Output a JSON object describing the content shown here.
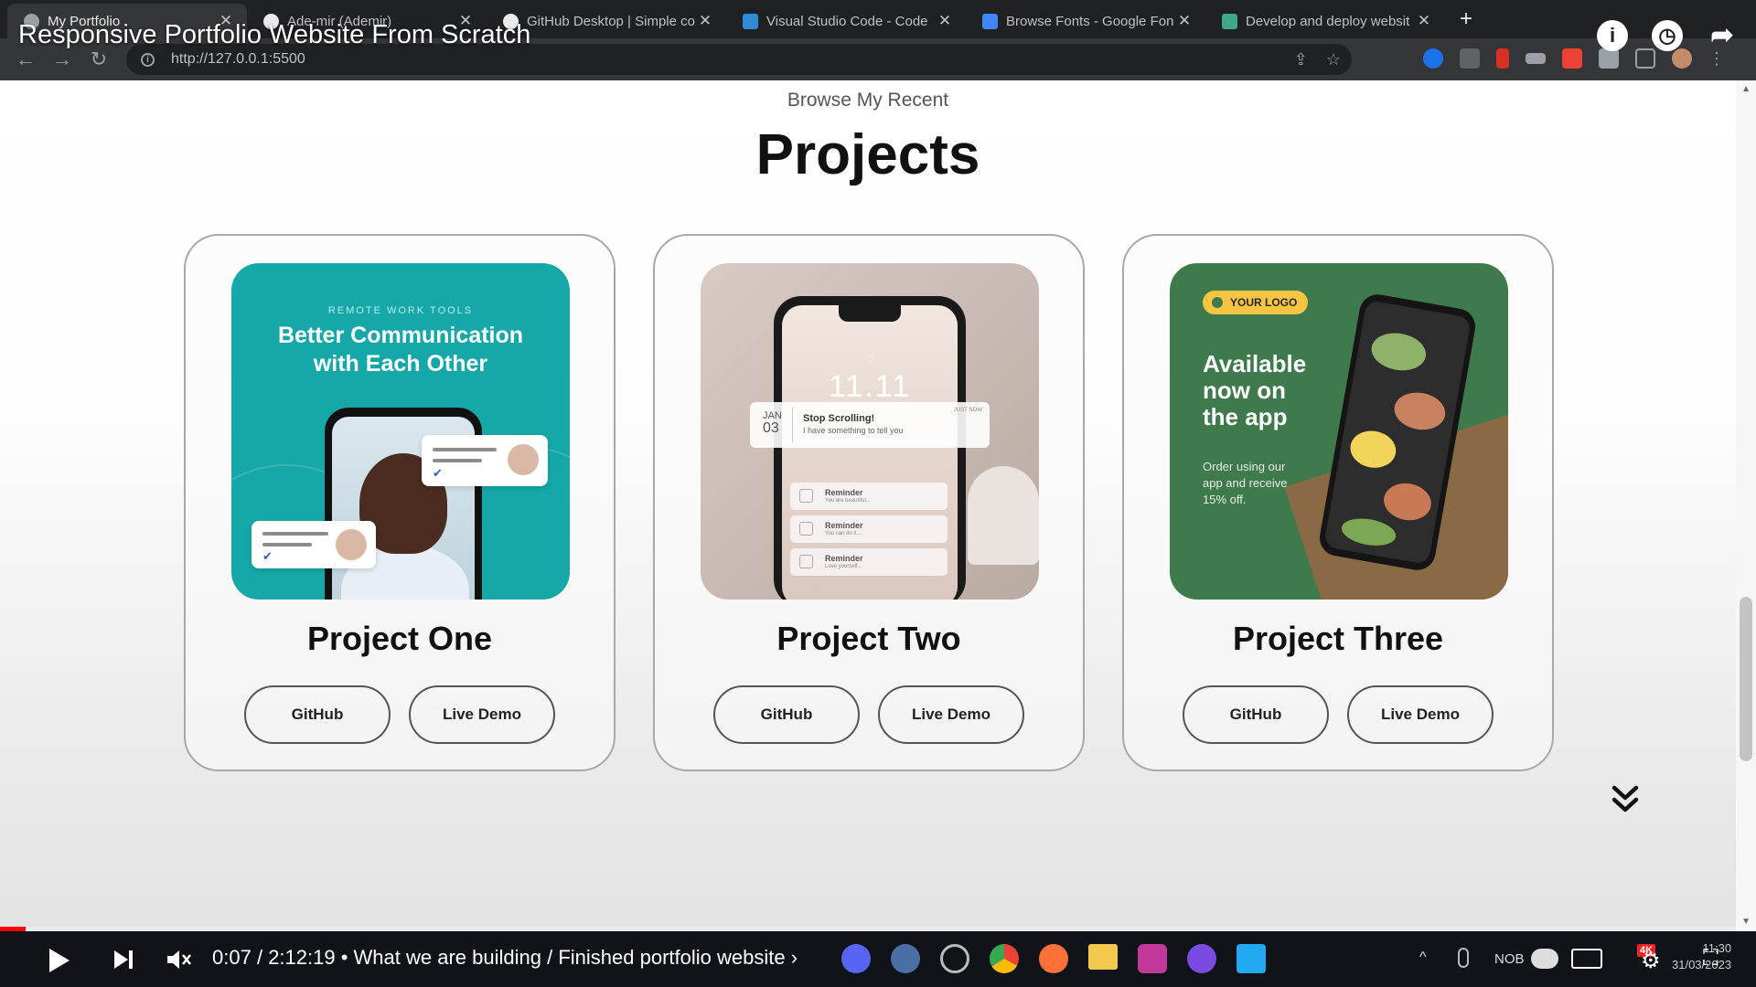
{
  "browser": {
    "tabs": [
      {
        "label": "My Portfolio",
        "active": true,
        "icon": "globe-icon"
      },
      {
        "label": "Ade-mir (Ademir)",
        "active": false,
        "icon": "github-icon"
      },
      {
        "label": "GitHub Desktop | Simple co",
        "active": false,
        "icon": "github-icon"
      },
      {
        "label": "Visual Studio Code - Code",
        "active": false,
        "icon": "vscode-icon"
      },
      {
        "label": "Browse Fonts - Google Fon",
        "active": false,
        "icon": "google-fonts-icon"
      },
      {
        "label": "Develop and deploy websit",
        "active": false,
        "icon": "netlify-icon"
      }
    ],
    "close_glyph": "✕",
    "new_tab_glyph": "+",
    "url": "http://127.0.0.1:5500"
  },
  "video": {
    "title": "Responsive Portfolio Website From Scratch",
    "time_current": "0:07",
    "time_total": "2:12:19",
    "chapter": "What we are building / Finished portfolio website",
    "progress_fraction": 0.001
  },
  "page": {
    "subtitle": "Browse My Recent",
    "title": "Projects",
    "projects": [
      {
        "title": "Project One",
        "github_label": "GitHub",
        "demo_label": "Live Demo",
        "image": {
          "kicker": "REMOTE WORK TOOLS",
          "heading_line1": "Better Communication",
          "heading_line2": "with Each Other"
        }
      },
      {
        "title": "Project Two",
        "github_label": "GitHub",
        "demo_label": "Live Demo",
        "image": {
          "clock": "11.11",
          "date_month": "JAN",
          "date_day": "03",
          "notification_title": "Stop Scrolling!",
          "notification_text": "I have something to tell you",
          "notification_time": "JUST NOW",
          "reminders": [
            {
              "title": "Reminder",
              "text": "You are beautiful..."
            },
            {
              "title": "Reminder",
              "text": "You can do it..."
            },
            {
              "title": "Reminder",
              "text": "Love yourself..."
            }
          ]
        }
      },
      {
        "title": "Project Three",
        "github_label": "GitHub",
        "demo_label": "Live Demo",
        "image": {
          "logo": "YOUR LOGO",
          "heading_line1": "Available",
          "heading_line2": "now on",
          "heading_line3": "the app",
          "sub_line1": "Order using our",
          "sub_line2": "app and receive",
          "sub_line3": "15% off."
        }
      }
    ],
    "scroll_down_glyph": "⌄⌄"
  },
  "taskbar": {
    "lang": "NOB",
    "clock_time": "11:30",
    "clock_date": "31/03/2023",
    "badge": "4K"
  },
  "colors": {
    "browser_bg": "#202124",
    "toolbar_bg": "#35363a",
    "youtube_red": "#ff0000",
    "card_border": "#a8a8a8",
    "teal": "#16a8a8",
    "green": "#3f7a4d",
    "logo_yellow": "#f4c542"
  }
}
